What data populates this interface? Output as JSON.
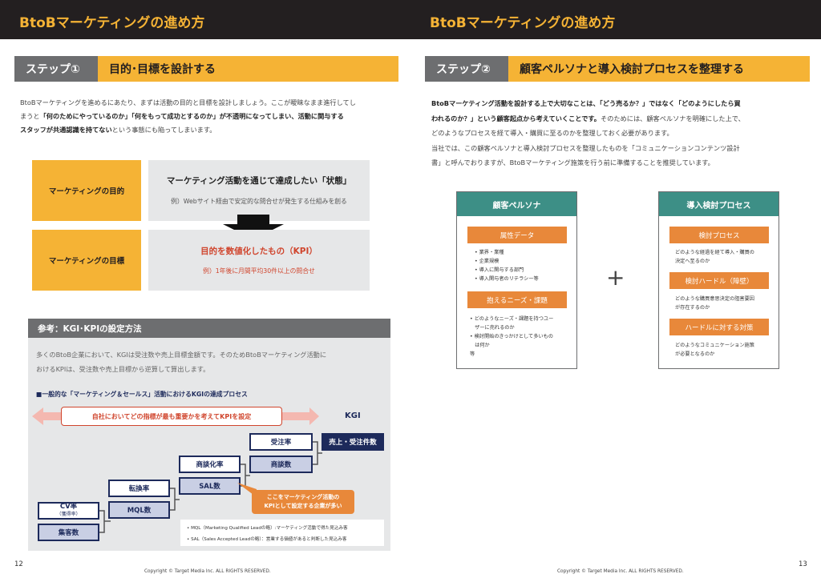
{
  "header": {
    "left_title": "BtoBマーケティングの進め方",
    "right_title": "BtoBマーケティングの進め方"
  },
  "left": {
    "step_num": "ステップ①",
    "step_title": "目的･目標を設計する",
    "intro_1": "BtoBマーケティングを進めるにあたり、まずは活動の目的と目標を設計しましょう。ここが曖昧なまま進行してし",
    "intro_2a": "まうと",
    "intro_2b": "「何のためにやっているのか」「何をもって成功とするのか」が不透明になってしまい、活動に関与する",
    "intro_3a": "スタッフが共通認識を持てない",
    "intro_3b": "という事態にも陥ってしまいます。",
    "purpose_label": "マーケティングの目的",
    "purpose_head": "マーケティング活動を通じて達成したい「状態」",
    "purpose_ex": "例）Webサイト経由で安定的な問合せが発生する仕組みを創る",
    "goal_label": "マーケティングの目標",
    "goal_head": "目的を数値化したもの（KPI）",
    "goal_ex": "例）1年後に月間平均30件以上の問合せ",
    "ref_title": "参考：KGI･KPIの設定方法",
    "ref_text_1": "多くのBtoB企業において、KGIは受注数や売上目標金額です。そのためBtoBマーケティング活動に",
    "ref_text_2": "おけるKPIは、受注数や売上目標から逆算して算出します。",
    "ref_sub": "■一般的な「マーケティング＆セールス」活動におけるKGIの達成プロセス",
    "arrow_text": "自社においてどの指標が最も重要かを考えてKPIを設定",
    "kgi": "KGI",
    "stairs": {
      "cv_rate": "CV率",
      "cv_rate_sub": "（獲得率）",
      "visitors": "集客数",
      "conv_rate": "転換率",
      "mql": "MQL数",
      "meeting_rate": "商談化率",
      "sal": "SAL数",
      "order_rate": "受注率",
      "meetings": "商談数",
      "sales": "売上・受注件数"
    },
    "callout": [
      "ここをマーケティング活動の",
      "KPIとして設定する企業が多い"
    ],
    "note_mql": "MQL（Marketing Qualified Leadの略）:マーケティング活動で得た見込み客",
    "note_sal": "SAL（Sales Accepted Leadの略）：営業する価値があると判断した見込み客",
    "page": "12",
    "copyright": "Copyright © Target Media Inc. ALL RIGHTS RESERVED."
  },
  "right": {
    "step_num": "ステップ②",
    "step_title": "顧客ペルソナと導入検討プロセスを整理する",
    "p1a": "BtoBマーケティング活動を設計する上で大切なことは、「どう売るか？」ではなく「どのようにしたら買",
    "p1b": "われるのか？」という顧客起点から考えていくことです。",
    "p1c": "そのためには、顧客ペルソナを明確にした上で、",
    "p2": "どのようなプロセスを経て導入・購買に至るのかを整理しておく必要があります。",
    "p3": "当社では、この顧客ペルソナと導入検討プロセスを整理したものを「コミュニケーションコンテンツ設計",
    "p4": "書」と呼んでおりますが、BtoBマーケティング施策を行う前に準備することを推奨しています。",
    "persona_title": "顧客ペルソナ",
    "persona_tag1": "属性データ",
    "persona_items1": [
      "• 業界・業種",
      "• 企業規模",
      "• 導入に関与する部門",
      "• 導入関与者のリテラシー等"
    ],
    "persona_tag2": "抱えるニーズ・課題",
    "persona_items2": [
      "• どのようなニーズ・課題を持つユー",
      "　ザーに売れるのか",
      "• 検討開始のきっかけとして多いもの",
      "　は何か",
      "等"
    ],
    "plus": "+",
    "process_title": "導入検討プロセス",
    "process_tag1": "検討プロセス",
    "process_text1": [
      "どのような経過を経て導入・購買の",
      "決定へ至るのか"
    ],
    "process_tag2": "検討ハードル（障壁）",
    "process_text2": [
      "どのような購買意思決定の阻害要因",
      "が存在するのか"
    ],
    "process_tag3": "ハードルに対する対策",
    "process_text3": [
      "どのようなコミュニケーション施策",
      "が必要となるのか"
    ],
    "page": "13",
    "copyright": "Copyright © Target Media Inc. ALL RIGHTS RESERVED."
  }
}
